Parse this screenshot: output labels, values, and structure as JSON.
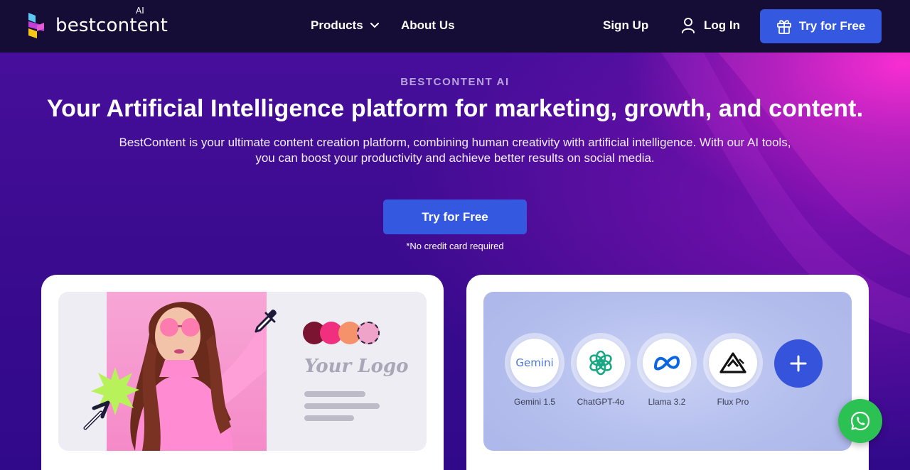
{
  "nav": {
    "brand": "bestcontent",
    "brand_suffix": "AI",
    "products_label": "Products",
    "about_label": "About Us",
    "signup_label": "Sign Up",
    "login_label": "Log In",
    "try_label": "Try for Free"
  },
  "hero": {
    "eyebrow": "BESTCONTENT AI",
    "headline": "Your Artificial Intelligence platform for marketing, growth, and content.",
    "subtitle_line1": "BestContent is your ultimate content creation platform, combining human creativity with artificial intelligence. With our AI tools,",
    "subtitle_line2": "you can boost your productivity and achieve better results on social media.",
    "cta_label": "Try for Free",
    "note": "*No credit card required"
  },
  "design_card": {
    "logo_placeholder": "Your Logo",
    "swatch_colors": [
      "#7a1430",
      "#f0307e",
      "#f5916b",
      "#f0a3c8"
    ]
  },
  "models_card": {
    "models": [
      {
        "label": "Gemini 1.5",
        "icon": "gemini-icon",
        "logo_text": "Gemini"
      },
      {
        "label": "ChatGPT-4o",
        "icon": "chatgpt-icon"
      },
      {
        "label": "Llama 3.2",
        "icon": "meta-icon"
      },
      {
        "label": "Flux Pro",
        "icon": "flux-icon"
      }
    ],
    "add_icon": "plus-icon"
  },
  "colors": {
    "nav_bg": "#150d36",
    "accent_blue": "#3558e0",
    "whatsapp_green": "#2bc253"
  }
}
